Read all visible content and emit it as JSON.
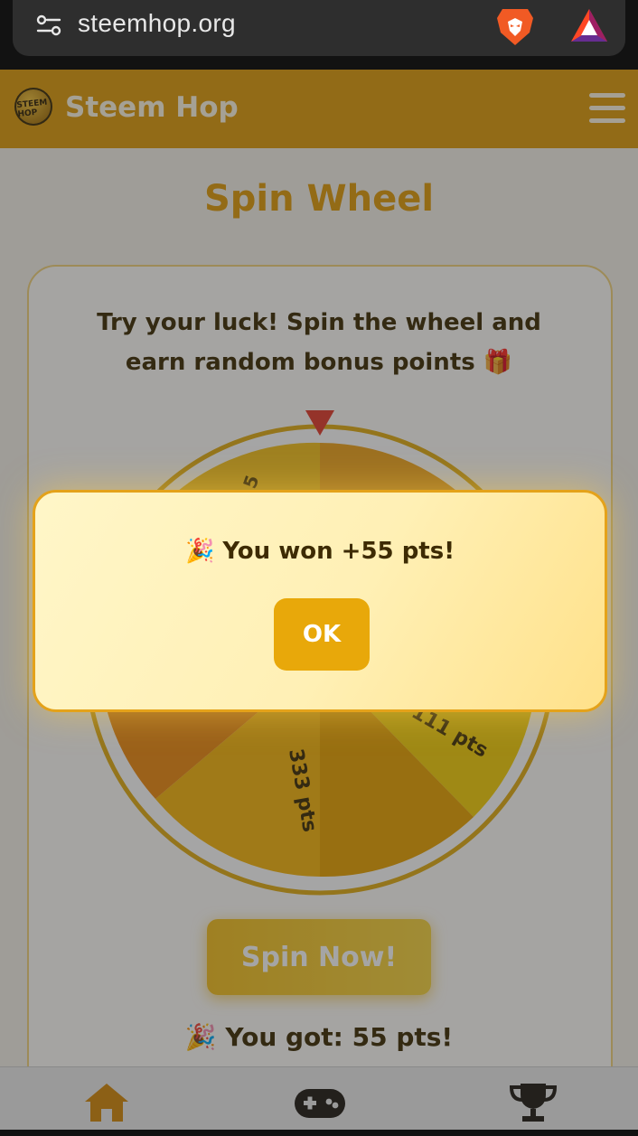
{
  "browser": {
    "url": "steemhop.org",
    "icons": [
      "site-settings-icon",
      "brave-lion-icon",
      "brave-rewards-icon"
    ]
  },
  "header": {
    "logo_text": "STEEM HOP",
    "brand": "Steem Hop",
    "menu_icon": "hamburger-menu-icon"
  },
  "page": {
    "title": "Spin Wheel",
    "intro": "Try your luck! Spin the wheel and earn random bonus points 🎁",
    "spin_label": "Spin Now!",
    "result_text": "🎉 You got: 55 pts!"
  },
  "wheel": {
    "segment_labels": [
      "5",
      "111 pts",
      "333 pts"
    ],
    "segment_colors": [
      "#f4c21c",
      "#f0a41d",
      "#f5cf08",
      "#e8a300",
      "#ee8a10",
      "#f7b60d"
    ]
  },
  "modal": {
    "message": "🎉 You won +55 pts!",
    "ok_label": "OK"
  },
  "tabbar": {
    "items": [
      {
        "name": "home",
        "icon": "home-icon"
      },
      {
        "name": "games",
        "icon": "gamepad-icon"
      },
      {
        "name": "leaderboard",
        "icon": "trophy-icon"
      }
    ]
  },
  "colors": {
    "brand": "#df9b0b",
    "accent": "#e09b0a",
    "text_dark": "#3d2b03"
  }
}
